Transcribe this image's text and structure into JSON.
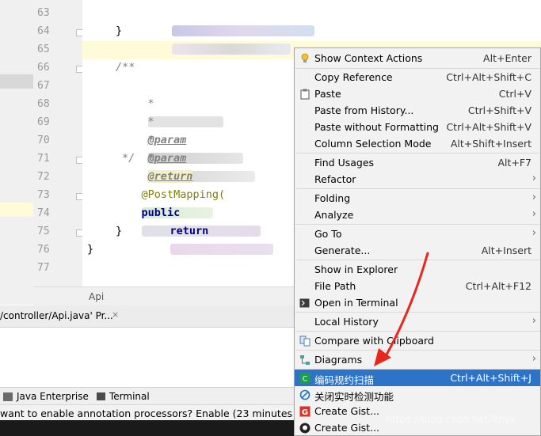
{
  "editor": {
    "line_numbers": [
      "63",
      "64",
      "65",
      "66",
      "67",
      "68",
      "69",
      "70",
      "71",
      "72",
      "73",
      "74",
      "75",
      "76",
      "77"
    ],
    "comment_open": "/**",
    "star": "*",
    "param_tag": "@param",
    "return_tag": "@return",
    "comment_close": "*/",
    "brace_close": "}",
    "annotation": "@PostMapping(",
    "keyword_public": "public",
    "keyword_return": "return",
    "tab_name": "Api"
  },
  "run_panel": {
    "tab_label": "/controller/Api.java' Pr...",
    "close": "×"
  },
  "tool_windows": [
    {
      "label": "Java Enterprise"
    },
    {
      "label": "Terminal"
    }
  ],
  "status_bar": {
    "message": "want to enable annotation processors? Enable (23 minutes ago)"
  },
  "context_menu": {
    "items": [
      {
        "label": "Show Context Actions",
        "shortcut": "Alt+Enter",
        "icon": "lightbulb-icon"
      },
      {
        "label": "Copy Reference",
        "shortcut": "Ctrl+Alt+Shift+C"
      },
      {
        "label": "Paste",
        "shortcut": "Ctrl+V",
        "icon": "clipboard-icon"
      },
      {
        "label": "Paste from History...",
        "shortcut": "Ctrl+Shift+V"
      },
      {
        "label": "Paste without Formatting",
        "shortcut": "Ctrl+Alt+Shift+V"
      },
      {
        "label": "Column Selection Mode",
        "shortcut": "Alt+Shift+Insert"
      },
      {
        "label": "Find Usages",
        "shortcut": "Alt+F7"
      },
      {
        "label": "Refactor",
        "shortcut": "",
        "submenu": true
      },
      {
        "label": "Folding",
        "shortcut": "",
        "submenu": true
      },
      {
        "label": "Analyze",
        "shortcut": "",
        "submenu": true
      },
      {
        "label": "Go To",
        "shortcut": "",
        "submenu": true
      },
      {
        "label": "Generate...",
        "shortcut": "Alt+Insert"
      },
      {
        "label": "Show in Explorer",
        "shortcut": ""
      },
      {
        "label": "File Path",
        "shortcut": "Ctrl+Alt+F12"
      },
      {
        "label": "Open in Terminal",
        "shortcut": "",
        "icon": "terminal-icon"
      },
      {
        "label": "Local History",
        "shortcut": "",
        "submenu": true
      },
      {
        "label": "Compare with Clipboard",
        "shortcut": "",
        "icon": "compare-icon"
      },
      {
        "label": "Diagrams",
        "shortcut": "",
        "submenu": true,
        "icon": "diagram-icon"
      },
      {
        "label": "编码规约扫描",
        "shortcut": "Ctrl+Alt+Shift+J",
        "icon": "p3c-scan-icon",
        "selected": true
      },
      {
        "label": "关闭实时检测功能",
        "shortcut": "",
        "icon": "disable-icon"
      },
      {
        "label": "Create Gist...",
        "shortcut": "",
        "icon": "gist-icon"
      },
      {
        "label": "Create Gist...",
        "shortcut": "",
        "icon": "github-icon"
      }
    ]
  },
  "watermark": "https://blog.csdn.net/lthyx",
  "colors": {
    "selection": "#2d74c8",
    "arrow": "#e8261c",
    "keyword": "#000080",
    "annotation": "#808000"
  }
}
